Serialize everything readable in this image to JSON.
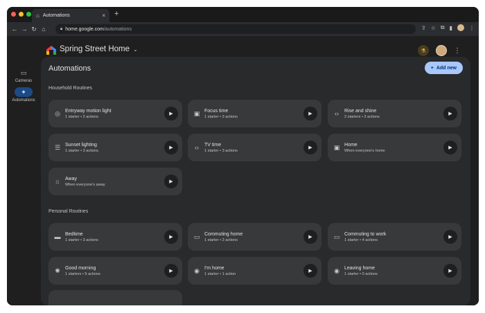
{
  "browser": {
    "tab_title": "Automations",
    "tab_close": "×",
    "new_tab": "+",
    "url_host": "home.google.com",
    "url_path": "/automations",
    "colors": {
      "red": "#ff5f57",
      "yellow": "#febc2e",
      "green": "#28c840"
    }
  },
  "header": {
    "home_name": "Spring Street Home"
  },
  "sidebar": {
    "items": [
      {
        "label": "Cameras",
        "icon": "▭"
      },
      {
        "label": "Automations",
        "icon": "✦"
      }
    ]
  },
  "main": {
    "title": "Automations",
    "add_label": "Add new",
    "household_label": "Household Routines",
    "personal_label": "Personal Routines",
    "household": [
      {
        "name": "Entryway motion light",
        "sub": "1 starter • 2 actions",
        "icon": "◎"
      },
      {
        "name": "Focus time",
        "sub": "1 starter • 3 actions",
        "icon": "▣"
      },
      {
        "name": "Rise and shine",
        "sub": "2 starters • 3 actions",
        "icon": "‹›"
      },
      {
        "name": "Sunset lighting",
        "sub": "1 starter • 3 actions",
        "icon": "☰"
      },
      {
        "name": "TV time",
        "sub": "1 starter • 3 actions",
        "icon": "‹›"
      },
      {
        "name": "Home",
        "sub": "When everyone's home",
        "icon": "▣"
      },
      {
        "name": "Away",
        "sub": "When everyone's away",
        "icon": "⌂"
      }
    ],
    "personal": [
      {
        "name": "Bedtime",
        "sub": "1 starter • 3 actions",
        "icon": "▬"
      },
      {
        "name": "Commuting home",
        "sub": "1 starter • 2 actions",
        "icon": "▭"
      },
      {
        "name": "Commuting to work",
        "sub": "1 starter • 4 actions",
        "icon": "▭"
      },
      {
        "name": "Good morning",
        "sub": "1 starters • 5 actions",
        "icon": "✺"
      },
      {
        "name": "I'm home",
        "sub": "1 starter • 1 action",
        "icon": "◉"
      },
      {
        "name": "Leaving home",
        "sub": "1 starter • 0 actions",
        "icon": "◉"
      }
    ]
  }
}
